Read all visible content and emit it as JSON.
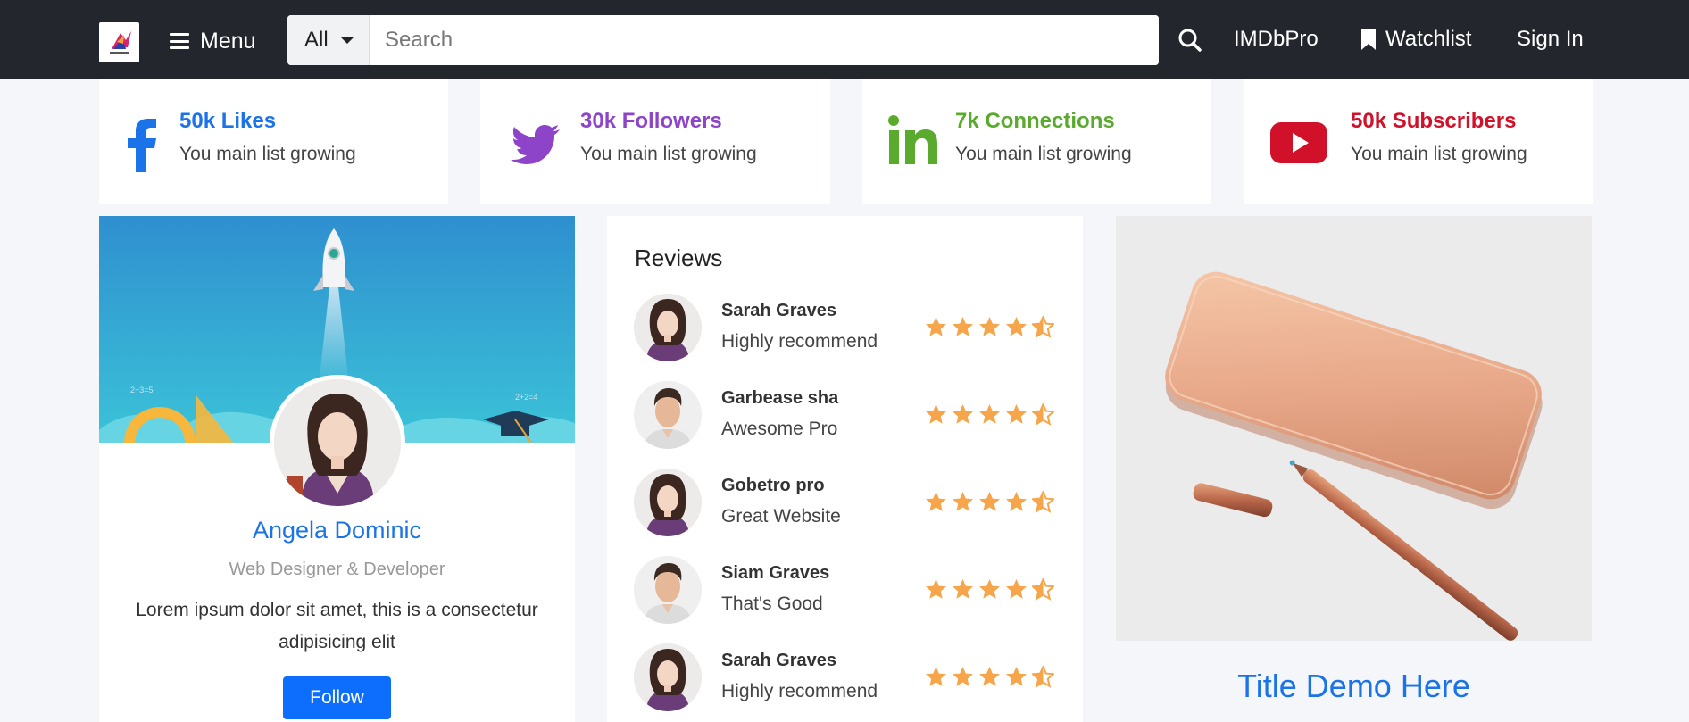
{
  "nav": {
    "menu_label": "Menu",
    "search_category": "All",
    "search_placeholder": "Search",
    "imdbpro_label": "IMDbPro",
    "watchlist_label": "Watchlist",
    "signin_label": "Sign In"
  },
  "stats": [
    {
      "icon": "facebook-icon",
      "title": "50k Likes",
      "subtitle": "You main list growing",
      "color": "#1a73e8"
    },
    {
      "icon": "twitter-icon",
      "title": "30k Followers",
      "subtitle": "You main list growing",
      "color": "#8e44c9"
    },
    {
      "icon": "linkedin-icon",
      "title": "7k Connections",
      "subtitle": "You main list growing",
      "color": "#5aab2d"
    },
    {
      "icon": "youtube-icon",
      "title": "50k Subscribers",
      "subtitle": "You main list growing",
      "color": "#d1102a"
    }
  ],
  "profile": {
    "name": "Angela Dominic",
    "role": "Web Designer & Developer",
    "bio": "Lorem ipsum dolor sit amet, this is a consectetur adipisicing elit",
    "follow_label": "Follow"
  },
  "reviews": {
    "title": "Reviews",
    "items": [
      {
        "name": "Sarah Graves",
        "text": "Highly recommend",
        "rating": 4.5,
        "avatar": "woman"
      },
      {
        "name": "Garbease sha",
        "text": "Awesome Pro",
        "rating": 4.5,
        "avatar": "man"
      },
      {
        "name": "Gobetro pro",
        "text": "Great Website",
        "rating": 4.5,
        "avatar": "woman"
      },
      {
        "name": "Siam Graves",
        "text": "That's Good",
        "rating": 4.5,
        "avatar": "man"
      },
      {
        "name": "Sarah Graves",
        "text": "Highly recommend",
        "rating": 4.5,
        "avatar": "woman"
      }
    ]
  },
  "product": {
    "title": "Title Demo Here"
  },
  "colors": {
    "navbar": "#23272d",
    "accent": "#1a73e8",
    "star": "#f6a54b",
    "button": "#0d6efd"
  }
}
